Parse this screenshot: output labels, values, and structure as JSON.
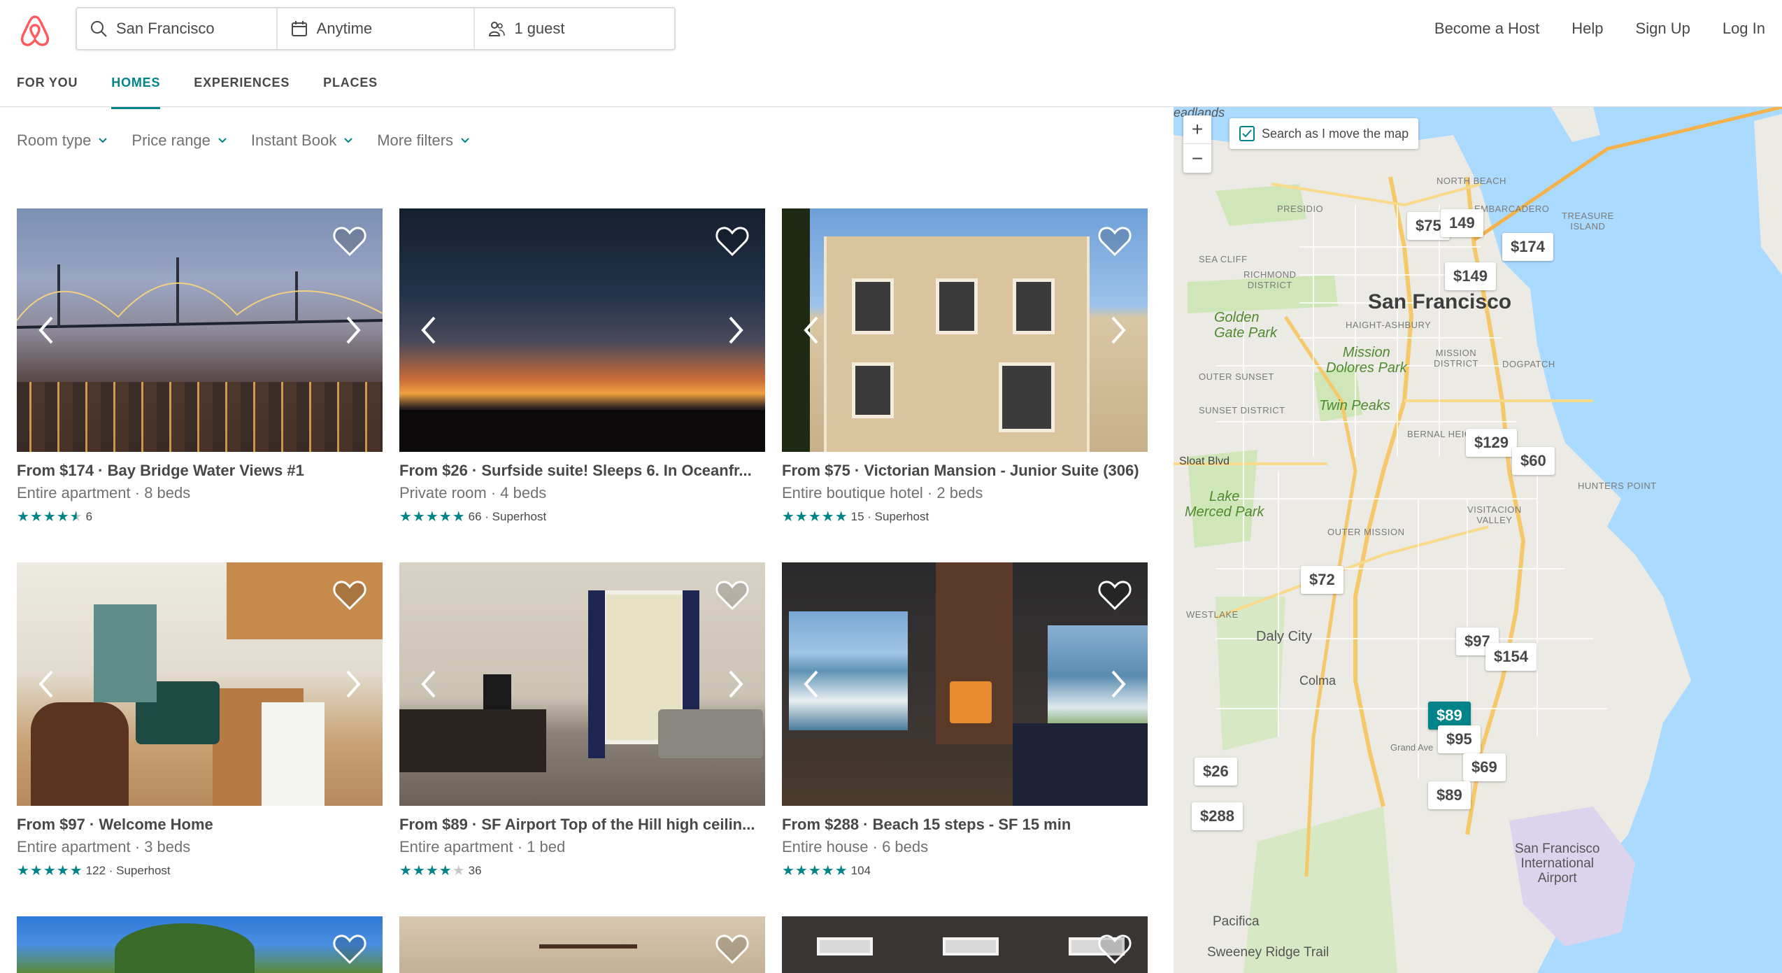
{
  "header": {
    "search": {
      "location": "San Francisco",
      "dates": "Anytime",
      "guests": "1 guest"
    },
    "nav": [
      "Become a Host",
      "Help",
      "Sign Up",
      "Log In"
    ]
  },
  "tabs": [
    {
      "label": "FOR YOU",
      "active": false
    },
    {
      "label": "HOMES",
      "active": true
    },
    {
      "label": "EXPERIENCES",
      "active": false
    },
    {
      "label": "PLACES",
      "active": false
    }
  ],
  "filters": [
    "Room type",
    "Price range",
    "Instant Book",
    "More filters"
  ],
  "listings": [
    {
      "title": "From $174 · Bay Bridge Water Views #1",
      "subtitle": "Entire apartment · 8 beds",
      "stars": 4.5,
      "rating_text": "6"
    },
    {
      "title": "From $26 · Surfside suite! Sleeps 6. In Oceanfr...",
      "subtitle": "Private room · 4 beds",
      "stars": 5,
      "rating_text": "66 · Superhost"
    },
    {
      "title": "From $75 · Victorian Mansion - Junior Suite (306)",
      "subtitle": "Entire boutique hotel · 2 beds",
      "stars": 5,
      "rating_text": "15 · Superhost"
    },
    {
      "title": "From $97 · Welcome Home",
      "subtitle": "Entire apartment · 3 beds",
      "stars": 5,
      "rating_text": "122 · Superhost"
    },
    {
      "title": "From $89 · SF Airport Top of the Hill high ceilin...",
      "subtitle": "Entire apartment · 1 bed",
      "stars": 4,
      "rating_text": "36"
    },
    {
      "title": "From $288 · Beach 15 steps - SF 15 min",
      "subtitle": "Entire house · 6 beds",
      "stars": 5,
      "rating_text": "104"
    }
  ],
  "map": {
    "search_as_move": "Search as I move the map",
    "checked": true,
    "labels": {
      "city": "San Francisco",
      "golden_gate": "Golden\nGate Park",
      "mission": "Mission\nDolores Park",
      "twin": "Twin Peaks",
      "lake": "Lake\nMerced Park",
      "daly": "Daly City",
      "colma": "Colma",
      "pacifica": "Pacifica",
      "sweeney": "Sweeney Ridge Trail",
      "airport": "San Francisco\nInternational\nAirport",
      "presidio": "PRESIDIO",
      "richmond": "RICHMOND\nDISTRICT",
      "outer_sunset": "OUTER SUNSET",
      "sunset": "SUNSET DISTRICT",
      "sea_cliff": "SEA CLIFF",
      "north_beach": "NORTH BEACH",
      "embarcadero": "EMBARCADERO",
      "haight": "HAIGHT-ASHBURY",
      "mission_district": "MISSION\nDISTRICT",
      "dogpatch": "DOGPATCH",
      "bernal": "BERNAL HEIGH",
      "hunters": "HUNTERS POINT",
      "visitacion": "VISITACION\nVALLEY",
      "outer_mission": "OUTER MISSION",
      "westlake": "WESTLAKE",
      "treasure": "TREASURE\nISLAND",
      "sloat": "Sloat Blvd",
      "grand": "Grand Ave",
      "headlands": "eadlands"
    },
    "pins": [
      {
        "price": "$75",
        "active": false
      },
      {
        "price": "149",
        "active": false
      },
      {
        "price": "$174",
        "active": false
      },
      {
        "price": "$149",
        "active": false
      },
      {
        "price": "$129",
        "active": false
      },
      {
        "price": "$60",
        "active": false
      },
      {
        "price": "$72",
        "active": false
      },
      {
        "price": "$97",
        "active": false
      },
      {
        "price": "$154",
        "active": false
      },
      {
        "price": "$89",
        "active": true
      },
      {
        "price": "$95",
        "active": false
      },
      {
        "price": "$69",
        "active": false
      },
      {
        "price": "$26",
        "active": false
      },
      {
        "price": "$89",
        "active": false
      },
      {
        "price": "$288",
        "active": false
      }
    ]
  }
}
